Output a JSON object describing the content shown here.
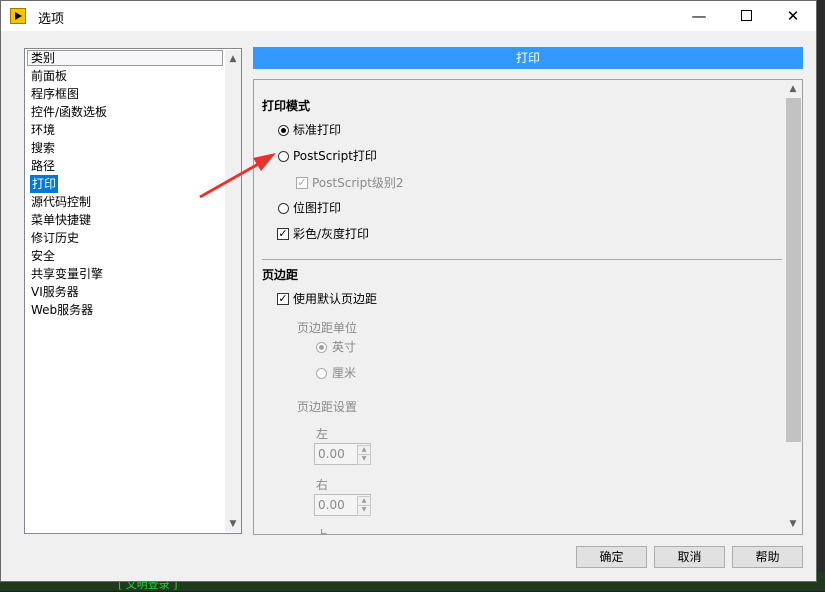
{
  "window": {
    "title": "选项"
  },
  "titlebar_icons": {
    "minimize": "minimize-icon",
    "maximize": "maximize-icon",
    "close": "close-icon"
  },
  "sidebar": {
    "header": "类别",
    "items": [
      {
        "label": "前面板"
      },
      {
        "label": "程序框图"
      },
      {
        "label": "控件/函数选板"
      },
      {
        "label": "环境"
      },
      {
        "label": "搜索"
      },
      {
        "label": "路径"
      },
      {
        "label": "打印",
        "selected": true
      },
      {
        "label": "源代码控制"
      },
      {
        "label": "菜单快捷键"
      },
      {
        "label": "修订历史"
      },
      {
        "label": "安全"
      },
      {
        "label": "共享变量引擎"
      },
      {
        "label": "VI服务器"
      },
      {
        "label": "Web服务器"
      }
    ]
  },
  "page_header": "打印",
  "print_mode": {
    "title": "打印模式",
    "standard": {
      "label": "标准打印",
      "selected": true
    },
    "postscript": {
      "label": "PostScript打印",
      "selected": false
    },
    "postscript_level2": {
      "label": "PostScript级别2",
      "checked": true,
      "disabled": true
    },
    "bitmap": {
      "label": "位图打印",
      "selected": false
    },
    "color_gray": {
      "label": "彩色/灰度打印",
      "checked": true
    }
  },
  "margins": {
    "title": "页边距",
    "use_default": {
      "label": "使用默认页边距",
      "checked": true
    },
    "unit_title": "页边距单位",
    "inch": {
      "label": "英寸",
      "selected": true
    },
    "cm": {
      "label": "厘米",
      "selected": false
    },
    "settings_title": "页边距设置",
    "left_label": "左",
    "left_value": "0.00",
    "right_label": "右",
    "right_value": "0.00",
    "top_label_partial": "上"
  },
  "buttons": {
    "ok": "确定",
    "cancel": "取消",
    "help": "帮助"
  },
  "colors": {
    "accent": "#3399ff",
    "selection": "#0078d7",
    "annotation_arrow": "#e8322b"
  },
  "backdrop_text": "[ 文明登录 ]"
}
